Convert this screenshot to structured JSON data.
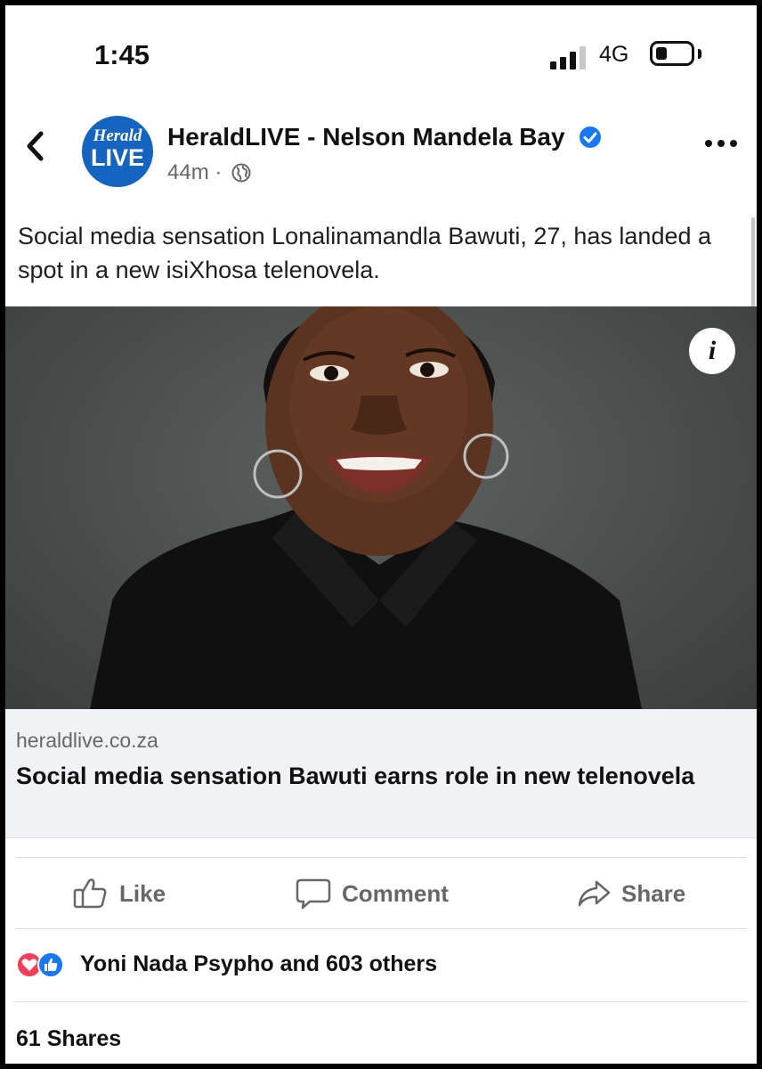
{
  "status_bar": {
    "time": "1:45",
    "network": "4G"
  },
  "header": {
    "logo_top": "Herald",
    "logo_bottom": "LIVE",
    "page_name": "HeraldLIVE - Nelson Mandela Bay",
    "time_ago": "44m",
    "separator": "·",
    "visibility_icon": "globe-icon"
  },
  "post": {
    "caption": "Social media sensation Lonalinamandla Bawuti, 27, has landed a spot in a new isiXhosa telenovela."
  },
  "link_preview": {
    "domain": "heraldlive.co.za",
    "title": "Social media sensation Bawuti earns role in new telenovela"
  },
  "actions": {
    "like": "Like",
    "comment": "Comment",
    "share": "Share"
  },
  "reactions": {
    "summary": "Yoni Nada Psypho and 603 others"
  },
  "footer": {
    "shares": "61 Shares"
  },
  "colors": {
    "accent": "#1877f2",
    "logo_blue": "#1565c0",
    "love": "#f33e58",
    "muted": "#65676b"
  }
}
